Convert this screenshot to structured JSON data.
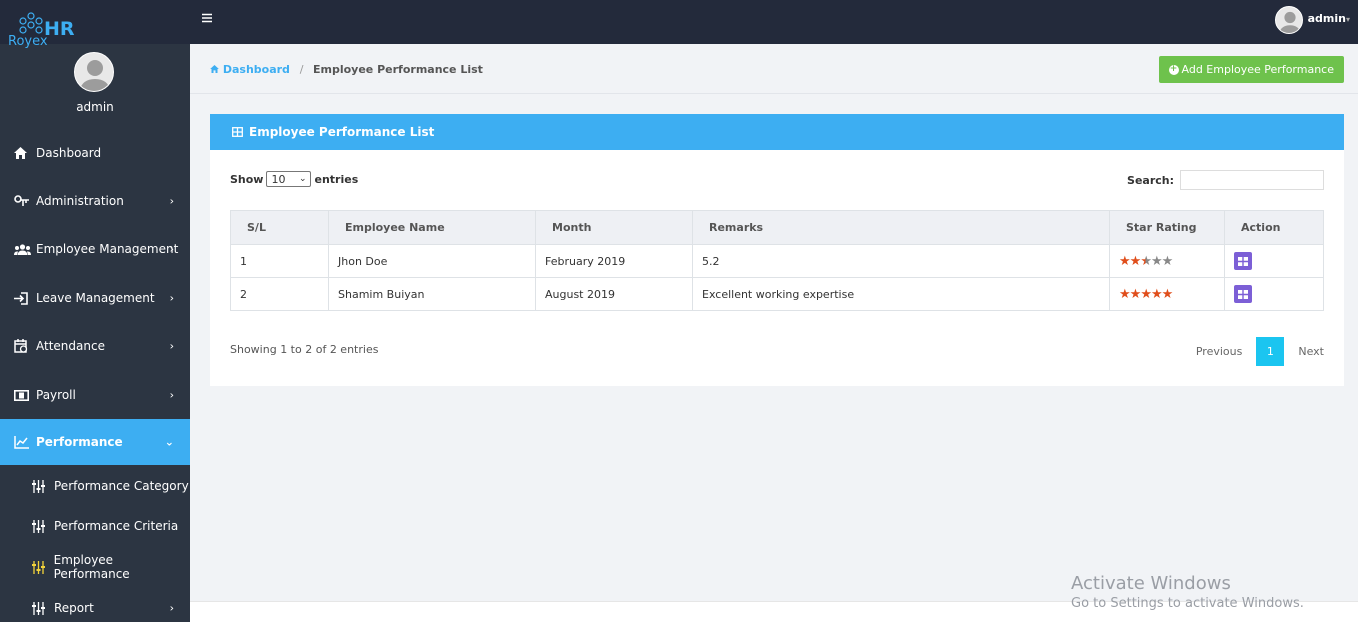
{
  "brand": {
    "hr": "HR",
    "name": "Royex"
  },
  "profile": {
    "name": "admin"
  },
  "topbar": {
    "user": "admin"
  },
  "menu": {
    "items": [
      {
        "label": "Dashboard"
      },
      {
        "label": "Administration"
      },
      {
        "label": "Employee Management"
      },
      {
        "label": "Leave Management"
      },
      {
        "label": "Attendance"
      },
      {
        "label": "Payroll"
      },
      {
        "label": "Performance"
      }
    ],
    "sub": [
      {
        "label": "Performance Category"
      },
      {
        "label": "Performance Criteria"
      },
      {
        "label": "Employee Performance"
      },
      {
        "label": "Report"
      }
    ]
  },
  "breadcrumb": {
    "home": "Dashboard",
    "sep": "/",
    "current": "Employee Performance List"
  },
  "actions": {
    "add": "Add Employee Performance"
  },
  "card": {
    "title": "Employee Performance List"
  },
  "table_controls": {
    "show": "Show",
    "entries_value": "10",
    "entries": "entries",
    "search": "Search:"
  },
  "table": {
    "headers": [
      "S/L",
      "Employee Name",
      "Month",
      "Remarks",
      "Star Rating",
      "Action"
    ],
    "rows": [
      {
        "sl": "1",
        "name": "Jhon Doe",
        "month": "February 2019",
        "remarks": "5.2",
        "rating": 2.5
      },
      {
        "sl": "2",
        "name": "Shamim Buiyan",
        "month": "August 2019",
        "remarks": "Excellent working expertise",
        "rating": 5
      }
    ]
  },
  "pagination": {
    "summary": "Showing 1 to 2 of 2 entries",
    "previous": "Previous",
    "page": "1",
    "next": "Next"
  },
  "windows": {
    "title": "Activate Windows",
    "subtitle": "Go to Settings to activate Windows."
  },
  "colors": {
    "sidebar": "#2c3542",
    "topbar": "#232a3b",
    "accent": "#3daef2",
    "success": "#6ec24c",
    "star": "#e04e1b",
    "action": "#7c5fd6"
  }
}
